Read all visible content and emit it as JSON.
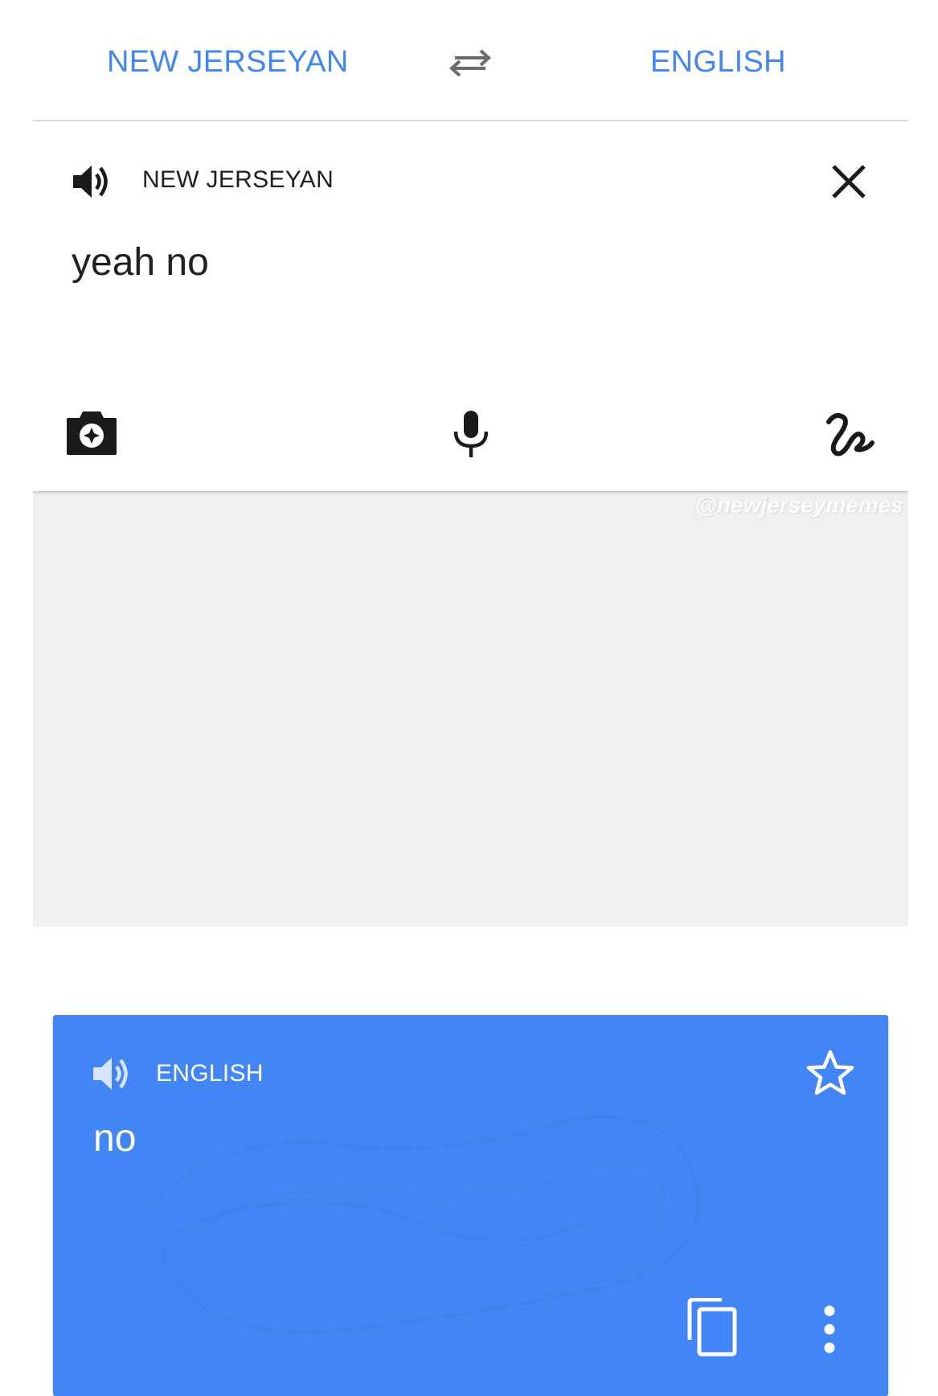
{
  "language_bar": {
    "source_language": "NEW JERSEYAN",
    "target_language": "ENGLISH",
    "swap_icon": "swap-arrows-icon"
  },
  "input": {
    "language_label": "NEW JERSEYAN",
    "text": "yeah no",
    "icons": [
      "speaker-icon",
      "close-icon",
      "camera-icon",
      "microphone-icon",
      "handwriting-icon"
    ]
  },
  "watermark": "@newjerseymemes",
  "result": {
    "language_label": "ENGLISH",
    "text": "no",
    "icons": [
      "speaker-icon",
      "star-icon",
      "copy-icon",
      "more-vert-icon"
    ]
  },
  "colors": {
    "accent": "#4285f4",
    "card_background": "#4285f4",
    "backdrop": "#efefef",
    "text_dark": "#202020"
  }
}
